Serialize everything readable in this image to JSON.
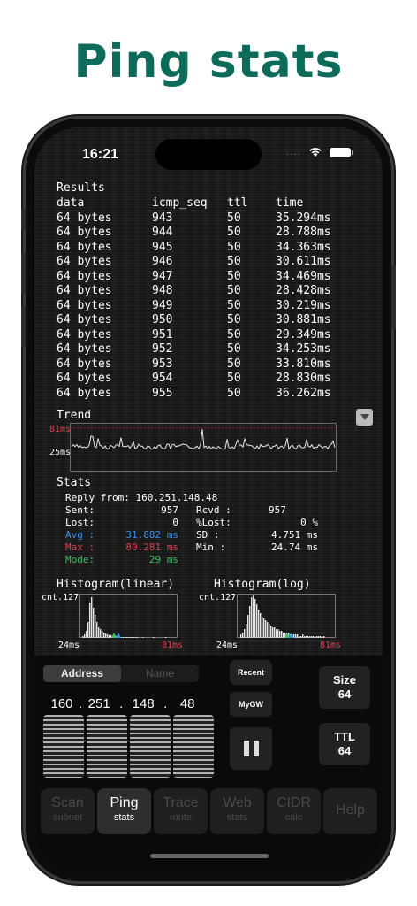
{
  "headline": "Ping stats",
  "status": {
    "time": "16:21",
    "signal": "....",
    "wifi_icon": "wifi-icon",
    "battery_icon": "battery-icon"
  },
  "results": {
    "title": "Results",
    "columns": [
      "data",
      "icmp_seq",
      "ttl",
      "time"
    ],
    "rows": [
      [
        "64 bytes",
        "943",
        "50",
        "35.294ms"
      ],
      [
        "64 bytes",
        "944",
        "50",
        "28.788ms"
      ],
      [
        "64 bytes",
        "945",
        "50",
        "34.363ms"
      ],
      [
        "64 bytes",
        "946",
        "50",
        "30.611ms"
      ],
      [
        "64 bytes",
        "947",
        "50",
        "34.469ms"
      ],
      [
        "64 bytes",
        "948",
        "50",
        "28.428ms"
      ],
      [
        "64 bytes",
        "949",
        "50",
        "30.219ms"
      ],
      [
        "64 bytes",
        "950",
        "50",
        "30.881ms"
      ],
      [
        "64 bytes",
        "951",
        "50",
        "29.349ms"
      ],
      [
        "64 bytes",
        "952",
        "50",
        "34.253ms"
      ],
      [
        "64 bytes",
        "953",
        "50",
        "33.810ms"
      ],
      [
        "64 bytes",
        "954",
        "50",
        "28.830ms"
      ],
      [
        "64 bytes",
        "955",
        "50",
        "36.262ms"
      ]
    ]
  },
  "trend": {
    "title": "Trend",
    "max_label": "81ms",
    "min_label": "25ms"
  },
  "stats": {
    "title": "Stats",
    "reply": "Reply from: 160.251.148.48",
    "sent_label": "Sent:",
    "sent": "957",
    "rcvd_label": "Rcvd :",
    "rcvd": "957",
    "lost_label": "Lost:",
    "lost": "0",
    "plost_label": "%Lost:",
    "plost": "0 %",
    "avg_label": "Avg :",
    "avg": "31.882 ms",
    "sd_label": "SD   :",
    "sd": "4.751 ms",
    "max_label": "Max :",
    "max": "80.281 ms",
    "min_label": "Min  :",
    "min": "24.74 ms",
    "mode_label": "Mode:",
    "mode": "29 ms",
    "avg_color": "#3a8fe8",
    "max_color": "#e04050",
    "mode_color": "#40c060"
  },
  "histogram": {
    "linear_title": "Histogram(linear)",
    "log_title": "Histogram(log)",
    "cnt_label": "cnt.127",
    "min_label": "24ms",
    "max_label": "81ms"
  },
  "controls": {
    "seg_address": "Address",
    "seg_name": "Name",
    "ip": [
      "160",
      ".",
      "251",
      ".",
      "148",
      ".",
      "48"
    ],
    "recent": "Recent",
    "mygw": "MyGW",
    "size_label": "Size",
    "size_value": "64",
    "ttl_label": "TTL",
    "ttl_value": "64"
  },
  "tabs": [
    {
      "t1": "Scan",
      "t2": "subnet"
    },
    {
      "t1": "Ping",
      "t2": "stats"
    },
    {
      "t1": "Trace",
      "t2": "route"
    },
    {
      "t1": "Web",
      "t2": "stats"
    },
    {
      "t1": "CIDR",
      "t2": "calc"
    },
    {
      "t1": "Help",
      "t2": ""
    }
  ]
}
